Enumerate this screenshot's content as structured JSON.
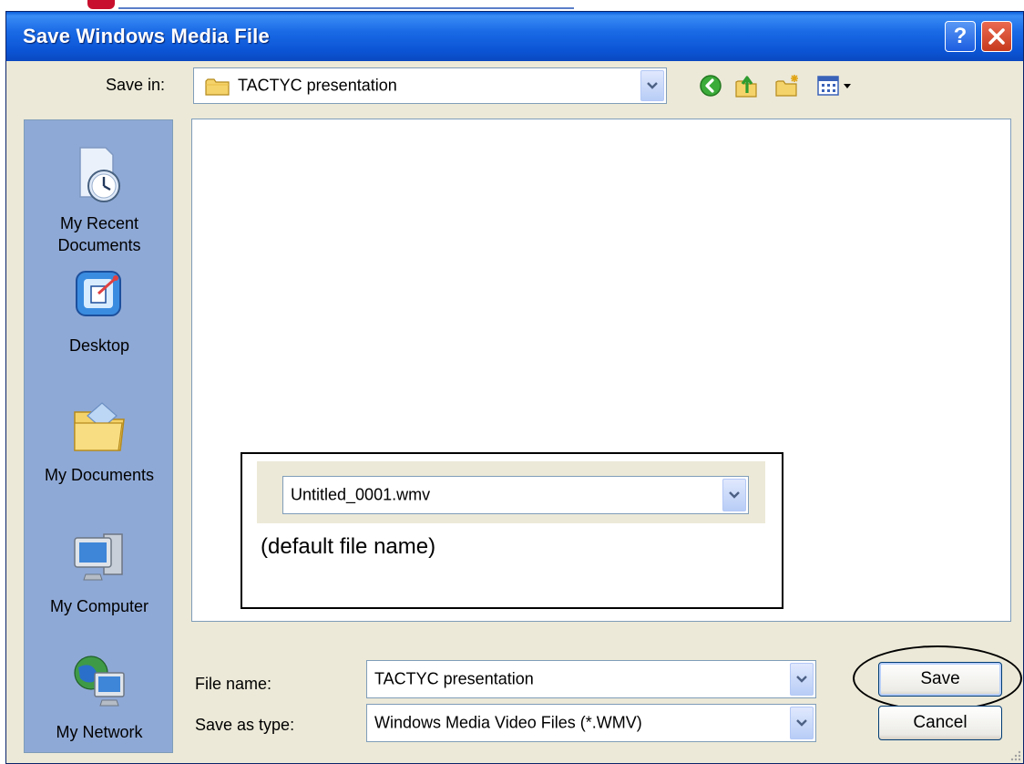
{
  "window": {
    "title": "Save Windows Media File"
  },
  "title_buttons": {
    "help": "?",
    "close": "X"
  },
  "save_in": {
    "label": "Save in:",
    "value": "TACTYC presentation"
  },
  "toolbar": {
    "icons": [
      "back-icon",
      "up-folder-icon",
      "new-folder-icon",
      "views-menu-icon"
    ]
  },
  "places": [
    {
      "label": "My Recent Documents",
      "line1": "My Recent",
      "line2": "Documents",
      "icon": "recent-documents-icon"
    },
    {
      "label": "Desktop",
      "icon": "desktop-icon"
    },
    {
      "label": "My Documents",
      "icon": "my-documents-icon"
    },
    {
      "label": "My Computer",
      "icon": "my-computer-icon"
    },
    {
      "label": "My Network",
      "icon": "my-network-icon"
    }
  ],
  "annotation": {
    "combo_value": "Untitled_0001.wmv",
    "caption": "(default file name)"
  },
  "file_name": {
    "label": "File name:",
    "value": "TACTYC presentation"
  },
  "save_as_type": {
    "label": "Save as type:",
    "value": "Windows Media Video Files (*.WMV)"
  },
  "buttons": {
    "save": "Save",
    "cancel": "Cancel"
  },
  "colors": {
    "titlebar": "#0a5fdb",
    "dialog_bg": "#ece9d8",
    "places_bar": "#8fa9d6",
    "close_button": "#c63a1e"
  }
}
